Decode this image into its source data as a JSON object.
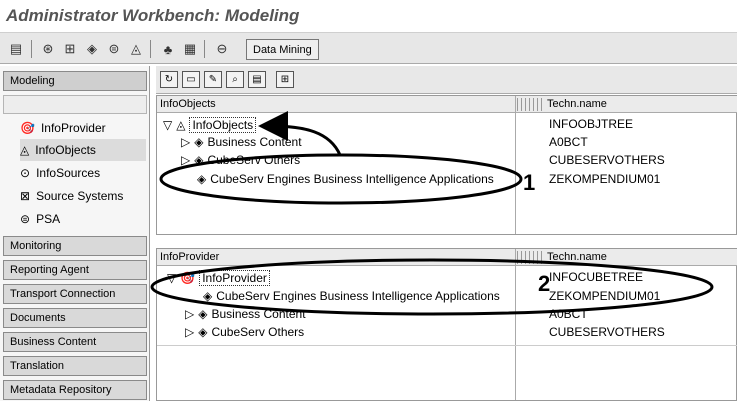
{
  "window": {
    "title": "Administrator Workbench: Modeling"
  },
  "toolbar": {
    "icons": [
      "layout-icon",
      "binoculars-icon",
      "hierarchy-icon",
      "cube-icon",
      "cylinder-icon",
      "infoobject-icon",
      "tree-icon",
      "table-icon",
      "link-icon"
    ],
    "data_mining_label": "Data Mining"
  },
  "sidebar": {
    "modeling_label": "Modeling",
    "items": [
      {
        "label": "InfoProvider",
        "icon": "infoprovider-icon"
      },
      {
        "label": "InfoObjects",
        "icon": "infoobject-icon",
        "selected": true
      },
      {
        "label": "InfoSources",
        "icon": "infosource-icon"
      },
      {
        "label": "Source Systems",
        "icon": "source-system-icon"
      },
      {
        "label": "PSA",
        "icon": "psa-icon"
      }
    ],
    "sections": [
      "Monitoring",
      "Reporting Agent",
      "Transport Connection",
      "Documents",
      "Business Content",
      "Translation",
      "Metadata Repository"
    ]
  },
  "panel_top": {
    "col_name": "InfoObjects",
    "col_tech": "Techn.name",
    "rows": [
      {
        "name": "InfoObjects",
        "tech": "INFOOBJTREE"
      },
      {
        "name": "Business Content",
        "tech": "A0BCT"
      },
      {
        "name": "CubeServ Others",
        "tech": "CUBESERVOTHERS"
      },
      {
        "name": "CubeServ Engines Business Intelligence Applications",
        "tech": "ZEKOMPENDIUM01"
      }
    ]
  },
  "panel_bottom": {
    "col_name": "InfoProvider",
    "col_tech": "Techn.name",
    "rows": [
      {
        "name": "InfoProvider",
        "tech": "INFOCUBETREE"
      },
      {
        "name": "CubeServ Engines Business Intelligence Applications",
        "tech": "ZEKOMPENDIUM01"
      },
      {
        "name": "Business Content",
        "tech": "A0BCT"
      },
      {
        "name": "CubeServ Others",
        "tech": "CUBESERVOTHERS"
      }
    ]
  },
  "annotations": {
    "label_1": "1",
    "label_2": "2"
  }
}
